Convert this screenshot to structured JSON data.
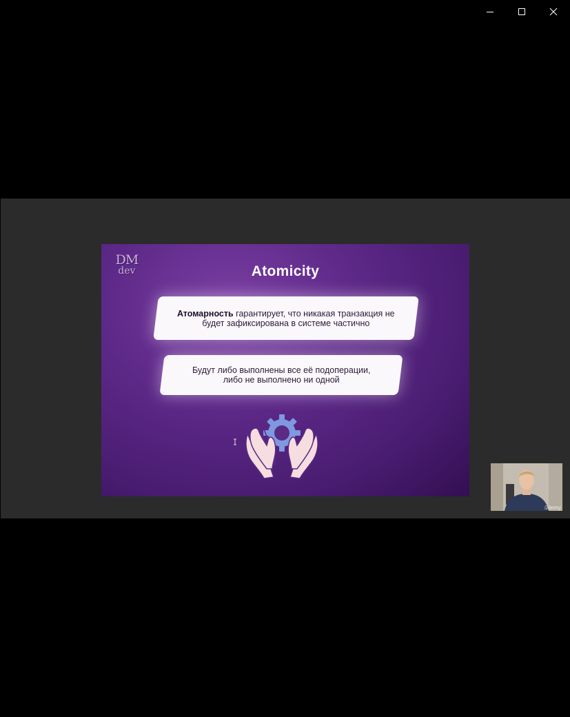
{
  "window": {
    "controls": {
      "minimize_icon": "minimize-icon",
      "maximize_icon": "maximize-icon",
      "close_icon": "close-icon"
    }
  },
  "slide": {
    "logo_top": "DM",
    "logo_bottom": "dev",
    "title": "Atomicity",
    "card1": {
      "bold": "Атомарность",
      "text_line1_rest": " гарантирует, что никакая транзакция не",
      "text_line2": "будет зафиксирована в системе частично"
    },
    "card2": {
      "line1": "Будут либо выполнены все её подоперации,",
      "line2": "либо не выполнено ни одной"
    },
    "illustration_icon": "hands-gear-icon"
  },
  "webcam": {
    "watermark": "ûdemy"
  },
  "colors": {
    "background": "#000000",
    "video_band": "#2b2b2b",
    "slide_purple": "#5f2a8a",
    "card_white": "#fbf8fc"
  }
}
